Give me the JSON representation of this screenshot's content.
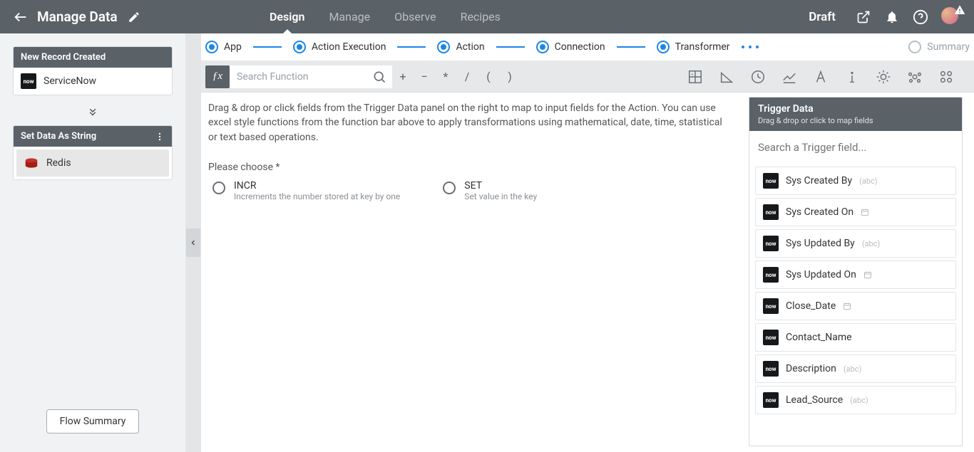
{
  "header": {
    "title": "Manage Data",
    "tabs": [
      "Design",
      "Manage",
      "Observe",
      "Recipes"
    ],
    "activeTab": "Design",
    "status": "Draft"
  },
  "sidebar": {
    "card1": {
      "title": "New Record Created",
      "item": "ServiceNow"
    },
    "card2": {
      "title": "Set Data As String",
      "item": "Redis"
    },
    "summaryButton": "Flow Summary"
  },
  "stepper": {
    "steps": [
      "App",
      "Action Execution",
      "Action",
      "Connection",
      "Transformer",
      "Summary"
    ],
    "activeIndex": 4
  },
  "funcBar": {
    "searchPlaceholder": "Search Function",
    "ops": [
      "+",
      "−",
      "*",
      "/",
      "(",
      ")"
    ]
  },
  "instructions": "Drag & drop or click fields from the Trigger Data panel on the right to map to input fields for the Action. You can use excel style functions from the function bar above to apply transformations using mathematical, date, time, statistical or text based operations.",
  "chooseLabel": "Please choose *",
  "options": [
    {
      "name": "INCR",
      "desc": "Increments the number stored at key by one"
    },
    {
      "name": "SET",
      "desc": "Set value in the key"
    }
  ],
  "trigger": {
    "title": "Trigger Data",
    "subtitle": "Drag & drop or click to map fields",
    "searchPlaceholder": "Search a Trigger field...",
    "fields": [
      {
        "label": "Sys Created By",
        "type": "abc"
      },
      {
        "label": "Sys Created On",
        "type": "date"
      },
      {
        "label": "Sys Updated By",
        "type": "abc"
      },
      {
        "label": "Sys Updated On",
        "type": "date"
      },
      {
        "label": "Close_Date",
        "type": "date"
      },
      {
        "label": "Contact_Name",
        "type": ""
      },
      {
        "label": "Description",
        "type": "abc"
      },
      {
        "label": "Lead_Source",
        "type": "abc"
      }
    ]
  }
}
